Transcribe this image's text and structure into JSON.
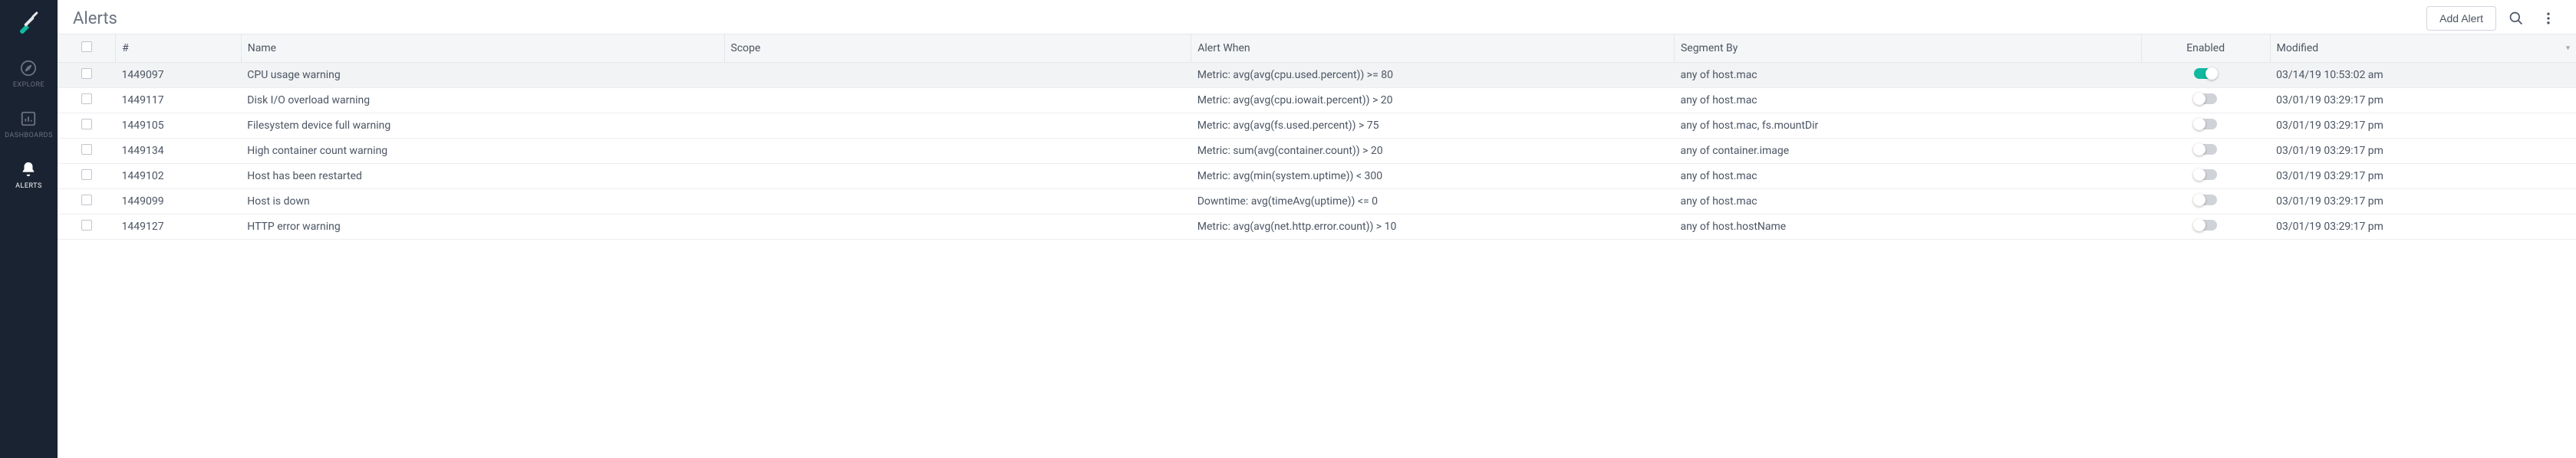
{
  "sidebar": {
    "items": [
      {
        "label": "EXPLORE"
      },
      {
        "label": "DASHBOARDS"
      },
      {
        "label": "ALERTS"
      }
    ]
  },
  "header": {
    "title": "Alerts",
    "add_button": "Add Alert"
  },
  "table": {
    "columns": [
      "#",
      "Name",
      "Scope",
      "Alert When",
      "Segment By",
      "Enabled",
      "Modified"
    ],
    "rows": [
      {
        "id": "1449097",
        "name": "CPU usage warning",
        "scope": "",
        "alert_when": "Metric: avg(avg(cpu.used.percent)) >= 80",
        "segment_by": "any of host.mac",
        "enabled": true,
        "modified": "03/14/19 10:53:02 am"
      },
      {
        "id": "1449117",
        "name": "Disk I/O overload warning",
        "scope": "",
        "alert_when": "Metric: avg(avg(cpu.iowait.percent)) > 20",
        "segment_by": "any of host.mac",
        "enabled": false,
        "modified": "03/01/19 03:29:17 pm"
      },
      {
        "id": "1449105",
        "name": "Filesystem device full warning",
        "scope": "",
        "alert_when": "Metric: avg(avg(fs.used.percent)) > 75",
        "segment_by": "any of host.mac, fs.mountDir",
        "enabled": false,
        "modified": "03/01/19 03:29:17 pm"
      },
      {
        "id": "1449134",
        "name": "High container count warning",
        "scope": "",
        "alert_when": "Metric: sum(avg(container.count)) > 20",
        "segment_by": "any of container.image",
        "enabled": false,
        "modified": "03/01/19 03:29:17 pm"
      },
      {
        "id": "1449102",
        "name": "Host has been restarted",
        "scope": "",
        "alert_when": "Metric: avg(min(system.uptime)) < 300",
        "segment_by": "any of host.mac",
        "enabled": false,
        "modified": "03/01/19 03:29:17 pm"
      },
      {
        "id": "1449099",
        "name": "Host is down",
        "scope": "",
        "alert_when": "Downtime: avg(timeAvg(uptime)) <= 0",
        "segment_by": "any of host.mac",
        "enabled": false,
        "modified": "03/01/19 03:29:17 pm"
      },
      {
        "id": "1449127",
        "name": "HTTP error warning",
        "scope": "",
        "alert_when": "Metric: avg(avg(net.http.error.count)) > 10",
        "segment_by": "any of host.hostName",
        "enabled": false,
        "modified": "03/01/19 03:29:17 pm"
      }
    ]
  }
}
